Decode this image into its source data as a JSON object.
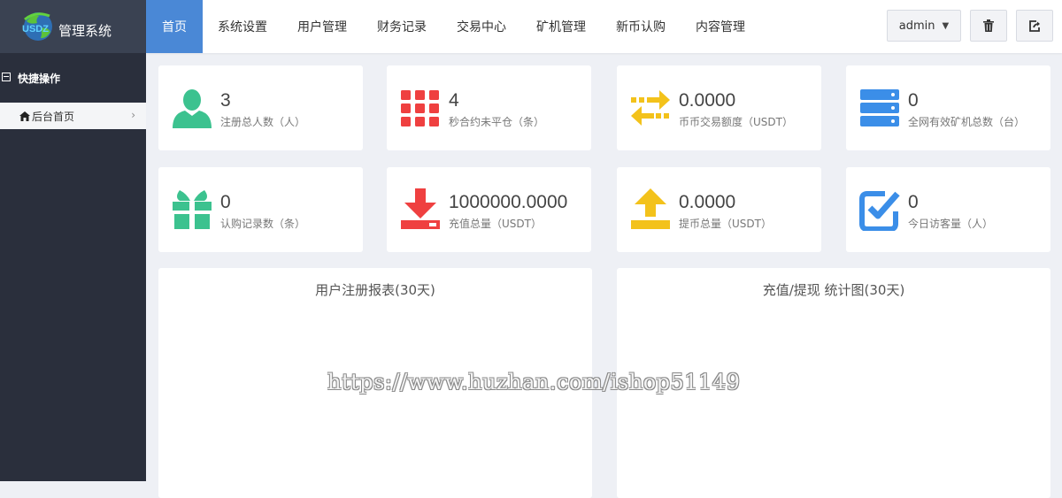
{
  "app": {
    "logo_text": "管理系统",
    "logo_letters": "USDZ"
  },
  "sidebar": {
    "section_title": "快捷操作",
    "items": [
      {
        "label": "后台首页"
      }
    ]
  },
  "nav": {
    "items": [
      {
        "label": "首页",
        "active": true
      },
      {
        "label": "系统设置"
      },
      {
        "label": "用户管理"
      },
      {
        "label": "财务记录"
      },
      {
        "label": "交易中心"
      },
      {
        "label": "矿机管理"
      },
      {
        "label": "新币认购"
      },
      {
        "label": "内容管理"
      }
    ],
    "user_label": "admin"
  },
  "stats": [
    {
      "value": "3",
      "label": "注册总人数（人）",
      "icon": "user-icon",
      "color": "#3cc28f"
    },
    {
      "value": "4",
      "label": "秒合约未平仓（条）",
      "icon": "grid-icon",
      "color": "#ef4040"
    },
    {
      "value": "0.0000",
      "label": "币币交易额度（USDT）",
      "icon": "exchange-icon",
      "color": "#f3c21b"
    },
    {
      "value": "0",
      "label": "全网有效矿机总数（台）",
      "icon": "server-icon",
      "color": "#3b8ee8"
    },
    {
      "value": "0",
      "label": "认购记录数（条）",
      "icon": "gift-icon",
      "color": "#3cc28f"
    },
    {
      "value": "1000000.0000",
      "label": "充值总量（USDT）",
      "icon": "download-icon",
      "color": "#ef4040"
    },
    {
      "value": "0.0000",
      "label": "提币总量（USDT）",
      "icon": "upload-icon",
      "color": "#f3c21b"
    },
    {
      "value": "0",
      "label": "今日访客量（人）",
      "icon": "check-square-icon",
      "color": "#3b8ee8"
    }
  ],
  "panels": [
    {
      "title": "用户注册报表(30天)"
    },
    {
      "title": "充值/提现 统计图(30天)"
    }
  ],
  "watermark": "https://www.huzhan.com/ishop51149"
}
